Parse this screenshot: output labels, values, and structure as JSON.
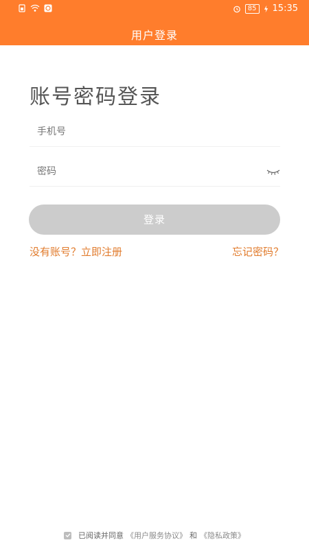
{
  "status_bar": {
    "time": "15:35",
    "battery": "85"
  },
  "header": {
    "title": "用户登录"
  },
  "login": {
    "heading": "账号密码登录",
    "phone_placeholder": "手机号",
    "password_placeholder": "密码",
    "login_button": "登录",
    "register_link": "没有账号？立即注册",
    "forgot_link": "忘记密码？"
  },
  "footer": {
    "text_prefix": "已阅读并同意",
    "user_agreement": "《用户服务协议》",
    "and": "和",
    "privacy_policy": "《隐私政策》"
  },
  "colors": {
    "accent": "#ff7d2c",
    "link": "#e17b2c",
    "button_disabled": "#cccccc"
  }
}
